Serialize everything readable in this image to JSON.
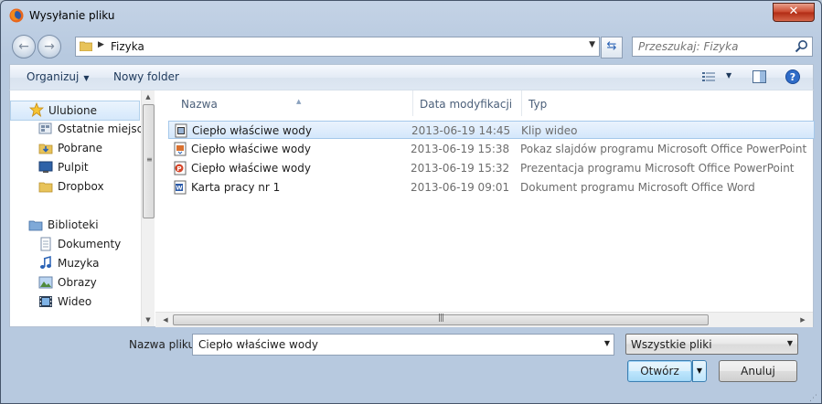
{
  "window": {
    "title": "Wysyłanie pliku"
  },
  "address": {
    "crumb": "Fizyka"
  },
  "search": {
    "placeholder": "Przeszukaj: Fizyka"
  },
  "toolbar": {
    "organize_label": "Organizuj",
    "new_folder_label": "Nowy folder"
  },
  "sidebar": {
    "favorites_label": "Ulubione",
    "favorites": [
      "Ostatnie miejsca",
      "Pobrane",
      "Pulpit",
      "Dropbox"
    ],
    "libraries_label": "Biblioteki",
    "libraries": [
      "Dokumenty",
      "Muzyka",
      "Obrazy",
      "Wideo"
    ]
  },
  "columns": {
    "name": "Nazwa",
    "date": "Data modyfikacji",
    "type": "Typ"
  },
  "files": [
    {
      "name": "Ciepło właściwe wody",
      "date": "2013-06-19 14:45",
      "type": "Klip wideo",
      "icon": "video-file-icon"
    },
    {
      "name": "Ciepło właściwe wody",
      "date": "2013-06-19 15:38",
      "type": "Pokaz slajdów programu Microsoft Office PowerPoint",
      "icon": "ppsx-file-icon"
    },
    {
      "name": "Ciepło właściwe wody",
      "date": "2013-06-19 15:32",
      "type": "Prezentacja programu Microsoft Office PowerPoint",
      "icon": "pptx-file-icon"
    },
    {
      "name": "Karta pracy nr 1",
      "date": "2013-06-19 09:01",
      "type": "Dokument programu Microsoft Office Word",
      "icon": "docx-file-icon"
    }
  ],
  "footer": {
    "filename_label": "Nazwa pliku:",
    "filename_value": "Ciepło właściwe wody",
    "filter_value": "Wszystkie pliki",
    "open_label": "Otwórz",
    "cancel_label": "Anuluj"
  }
}
